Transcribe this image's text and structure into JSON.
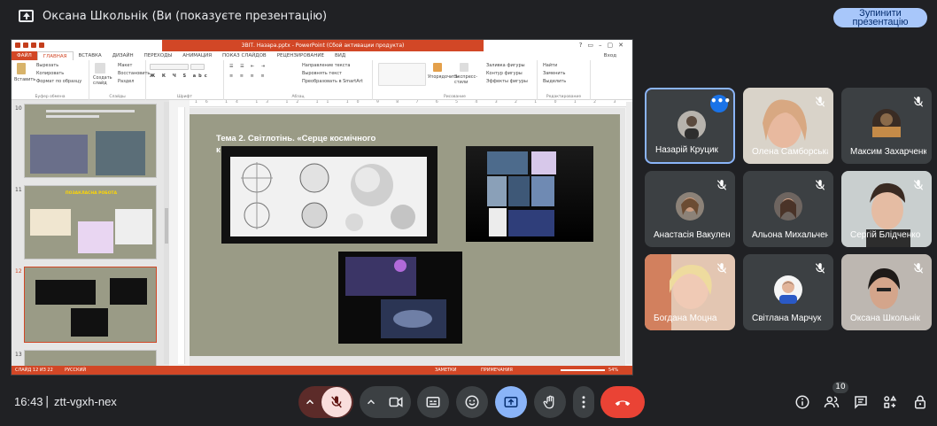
{
  "topbar": {
    "title": "Оксана Школьнік (Ви (показуєте презентацію)",
    "stop_line1": "Зупинити",
    "stop_line2": "презентацію"
  },
  "powerpoint": {
    "window_title": "ЗВІТ. Назара.pptx - PowerPoint (Сбой активации продукта)",
    "signin": "Вход",
    "tabs": [
      "ФАЙЛ",
      "ГЛАВНАЯ",
      "ВСТАВКА",
      "ДИЗАЙН",
      "ПЕРЕХОДЫ",
      "АНИМАЦИЯ",
      "ПОКАЗ СЛАЙДОВ",
      "РЕЦЕНЗИРОВАНИЕ",
      "ВИД"
    ],
    "ribbon": {
      "paste": "Вставить",
      "cut": "Вырезать",
      "copy": "Копировать",
      "format_painter": "Формат по образцу",
      "clipboard": "Буфер обмена",
      "new_slide": "Создать слайд",
      "layout": "Макет",
      "reset": "Восстановить",
      "section": "Раздел",
      "slides": "Слайды",
      "font": "Шрифт",
      "paragraph": "Абзац",
      "text_direction": "Направление текста",
      "align_text": "Выровнять текст",
      "smartart": "Преобразовать в SmartArt",
      "arrange": "Упорядочить",
      "quick_styles": "Экспресс-стили",
      "shape_fill": "Заливка фигуры",
      "shape_outline": "Контур фигуры",
      "shape_effects": "Эффекты фигуры",
      "drawing": "Рисование",
      "find": "Найти",
      "replace": "Заменить",
      "select": "Выделить",
      "editing": "Редактирование"
    },
    "ruler": "16 14 13 12 11 10 9 8 7 6 5 4 3 2 1 0 1 2 3 4 5 6 7 8 9 10 11 12 13 14 15 16",
    "slide_numbers": [
      "10",
      "11",
      "12",
      "13"
    ],
    "thumb11_title": "ПОЗАКЛАСНА РОБОТА",
    "slide_title": "Тема 2.  Світлотінь. «Серце космічного",
    "slide_title2": "к",
    "status_slide": "СЛАЙД 12 ИЗ 22",
    "status_lang": "РУССКИЙ",
    "status_notes": "ЗАМЕТКИ",
    "status_comments": "ПРИМЕЧАНИЯ",
    "zoom": "54%"
  },
  "participants": [
    {
      "name": "Назарій Круцик",
      "muted": false,
      "active": true
    },
    {
      "name": "Олена Самборська",
      "muted": true
    },
    {
      "name": "Максим Захарченко",
      "muted": true
    },
    {
      "name": "Анастасія Вакуленко",
      "muted": true
    },
    {
      "name": "Альона Михальченко",
      "muted": true
    },
    {
      "name": "Сергій Блідченко",
      "muted": true
    },
    {
      "name": "Богдана Моцна",
      "muted": true
    },
    {
      "name": "Світлана Марчук",
      "muted": true
    },
    {
      "name": "Оксана Школьнік",
      "muted": true
    }
  ],
  "bottombar": {
    "time": "16:43",
    "separator": "|",
    "meeting_code": "ztt-vgxh-nex",
    "people_count": "10"
  },
  "colors": {
    "background": "#202124",
    "tile": "#3c4043",
    "accent": "#8ab4f8",
    "present_active": "#8ab4f8",
    "end_call": "#ea4335",
    "mic_muted": "#f9dedc",
    "powerpoint": "#d24726"
  }
}
